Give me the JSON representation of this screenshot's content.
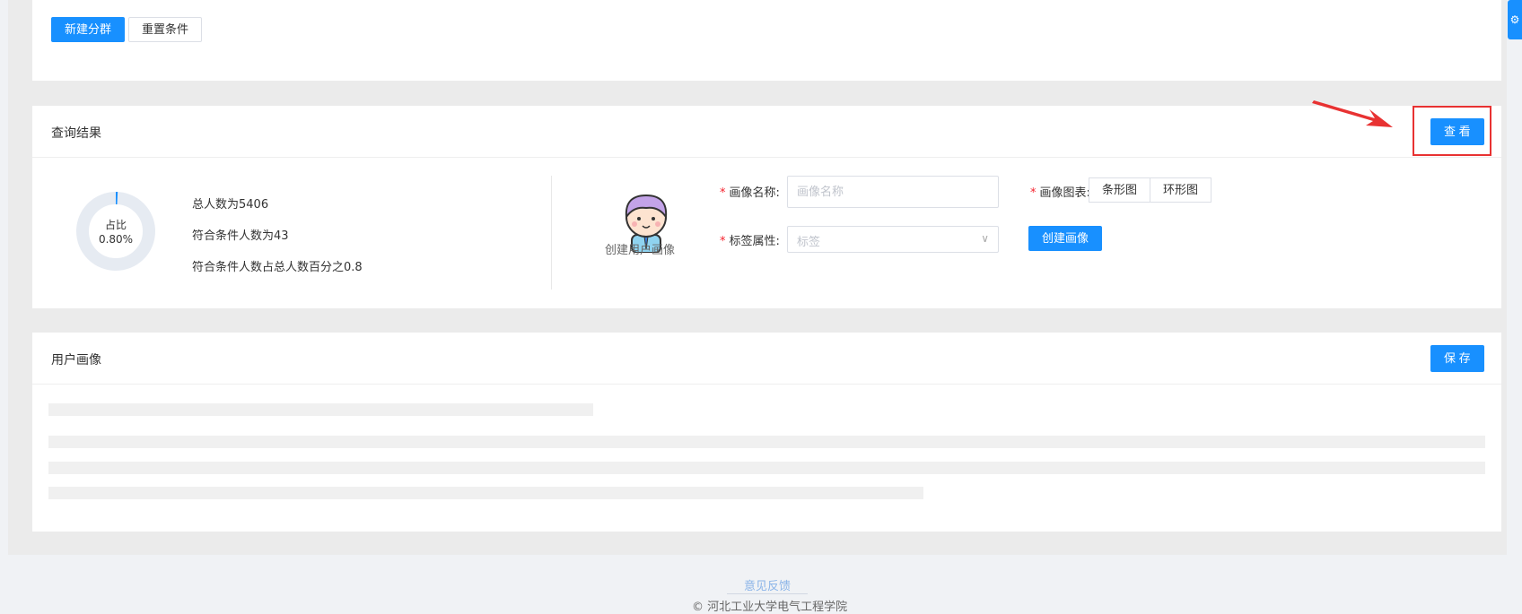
{
  "top_actions": {
    "new_group": "新建分群",
    "reset_conditions": "重置条件"
  },
  "query": {
    "title": "查询结果",
    "view_button": "查 看",
    "donut": {
      "label": "占比",
      "percent": "0.80%",
      "fraction": 0.008
    },
    "stats": [
      "总人数为5406",
      "符合条件人数为43",
      "符合条件人数占总人数百分之0.8"
    ],
    "avatar_caption": "创建用户画像",
    "form": {
      "name_label": "画像名称:",
      "name_placeholder": "画像名称",
      "chart_label": "画像图表:",
      "chart_options": [
        "条形图",
        "环形图"
      ],
      "tag_label": "标签属性:",
      "tag_placeholder": "标签",
      "create_button": "创建画像"
    }
  },
  "profile": {
    "title": "用户画像",
    "save_button": "保 存"
  },
  "footer": {
    "feedback": "意见反馈",
    "copyright": "© 河北工业大学电气工程学院"
  },
  "colors": {
    "primary": "#1890ff",
    "highlight": "#e83232",
    "required": "#f5222d"
  }
}
